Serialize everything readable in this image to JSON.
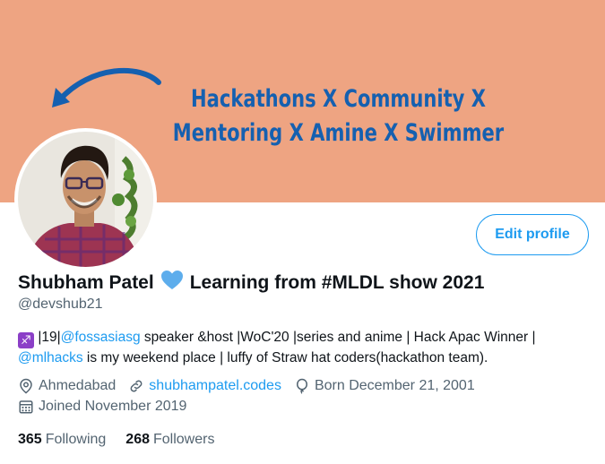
{
  "banner": {
    "text": "Hackathons X Community X Mentoring X Amine X Swimmer",
    "background_color": "#eea482",
    "text_color": "#1560b0"
  },
  "profile": {
    "name": "Shubham Patel",
    "name_emoji": "blue-heart-icon",
    "name_suffix": "Learning from #MLDL show 2021",
    "handle": "@devshub21",
    "edit_label": "Edit profile",
    "bio": {
      "emoji": "sagittarius-icon",
      "part1": "|19|",
      "mention1": "@fossasiasg",
      "part2": " speaker &host |WoC'20 |series and anime | Hack Apac Winner | ",
      "mention2": "@mlhacks",
      "part3": " is my weekend place | luffy of Straw hat coders(hackathon team)."
    },
    "location": "Ahmedabad",
    "website": "shubhampatel.codes",
    "birthday": "Born December 21, 2001",
    "joined": "Joined November 2019",
    "following_count": "365",
    "following_label": "Following",
    "followers_count": "268",
    "followers_label": "Followers"
  },
  "colors": {
    "accent": "#1d9bf0",
    "secondary_text": "#536471"
  }
}
